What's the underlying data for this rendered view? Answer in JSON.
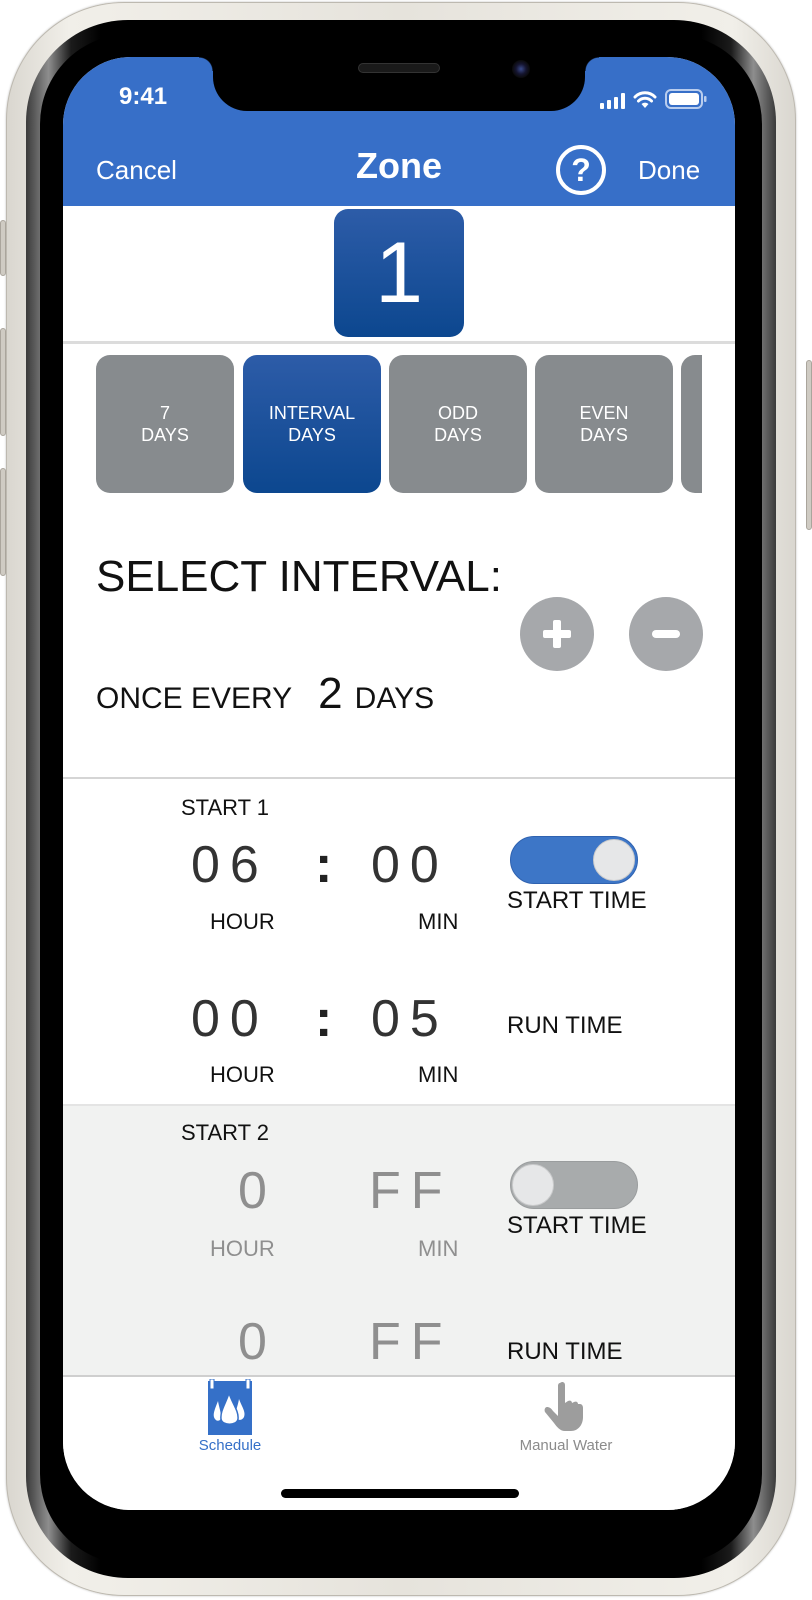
{
  "status_bar": {
    "time": "9:41",
    "icons": [
      "cellular-signal-icon",
      "wifi-icon",
      "battery-icon"
    ]
  },
  "nav": {
    "cancel_label": "Cancel",
    "title": "Zone",
    "help_icon": "?",
    "done_label": "Done"
  },
  "zone": {
    "number": "1"
  },
  "mode_tabs": [
    {
      "line1": "7",
      "line2": "DAYS",
      "active": false
    },
    {
      "line1": "INTERVAL",
      "line2": "DAYS",
      "active": true
    },
    {
      "line1": "ODD",
      "line2": "DAYS",
      "active": false
    },
    {
      "line1": "EVEN",
      "line2": "DAYS",
      "active": false
    },
    {
      "line1": "",
      "line2": "",
      "active": false
    }
  ],
  "interval": {
    "title": "SELECT INTERVAL:",
    "prefix": "ONCE EVERY",
    "value": "2",
    "suffix": "DAYS",
    "plus_icon": "plus-icon",
    "minus_icon": "minus-icon"
  },
  "starts": [
    {
      "label": "START 1",
      "start_time": {
        "hour": "06",
        "colon": ":",
        "min": "00",
        "hour_label": "HOUR",
        "min_label": "MIN",
        "label": "START TIME",
        "enabled": true
      },
      "run_time": {
        "hour": "00",
        "colon": ":",
        "min": "05",
        "hour_label": "HOUR",
        "min_label": "MIN",
        "label": "RUN TIME"
      }
    },
    {
      "label": "START 2",
      "start_time": {
        "hour": "0",
        "min": "FF",
        "hour_label": "HOUR",
        "min_label": "MIN",
        "label": "START TIME",
        "enabled": false
      },
      "run_time": {
        "hour": "0",
        "min": "FF",
        "label": "RUN TIME"
      }
    }
  ],
  "tab_bar": {
    "items": [
      {
        "label": "Schedule",
        "icon": "water-drops-calendar-icon",
        "active": true
      },
      {
        "label": "Manual Water",
        "icon": "hand-pointer-icon",
        "active": false
      }
    ]
  },
  "colors": {
    "header_blue": "#376fc8",
    "selected_blue": "#0c478f",
    "tab_gray": "#878b8e",
    "toggle_on": "#3d76c7",
    "toggle_off": "#a8abac"
  }
}
